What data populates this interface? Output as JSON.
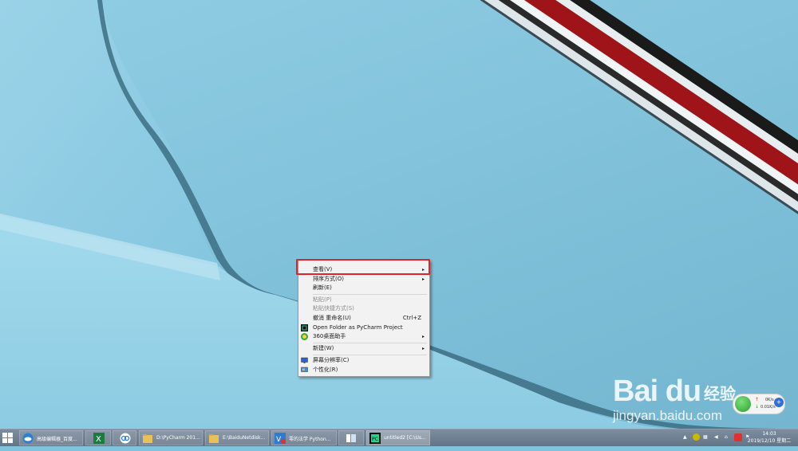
{
  "menu": {
    "items": [
      {
        "label": "查看(V)",
        "has_submenu": true,
        "disabled": false
      },
      {
        "label": "排序方式(O)",
        "has_submenu": true,
        "disabled": false
      },
      {
        "label": "刷新(E)",
        "has_submenu": false,
        "disabled": false
      },
      {
        "label": "粘贴(P)",
        "has_submenu": false,
        "disabled": true
      },
      {
        "label": "粘贴快捷方式(S)",
        "has_submenu": false,
        "disabled": true
      },
      {
        "label": "撤消 重命名(U)",
        "shortcut": "Ctrl+Z",
        "has_submenu": false,
        "disabled": false
      },
      {
        "label": "Open Folder as PyCharm Project",
        "icon": "pycharm-icon",
        "has_submenu": false,
        "disabled": false
      },
      {
        "label": "360桌面助手",
        "icon": "360-icon",
        "has_submenu": true,
        "disabled": false
      },
      {
        "label": "新建(W)",
        "has_submenu": true,
        "disabled": false
      },
      {
        "label": "屏幕分辨率(C)",
        "icon": "monitor-icon",
        "has_submenu": false,
        "disabled": false
      },
      {
        "label": "个性化(R)",
        "icon": "personalize-icon",
        "has_submenu": false,
        "disabled": false
      }
    ],
    "submenu_arrow": "▸"
  },
  "watermark": {
    "brand": "Bai du",
    "site": "jingyan.baidu.com",
    "tag": "经验"
  },
  "net_speed": {
    "up": "0K/s",
    "down": "0.01K/s",
    "up_arrow": "↑",
    "down_arrow": "↓",
    "plus": "+"
  },
  "taskbar": {
    "start_icon": "windows-logo-icon",
    "items": [
      {
        "label": "高级编辑器_百度...",
        "icon": "cloud-icon"
      },
      {
        "label": "",
        "icon": "excel-icon"
      },
      {
        "label": "",
        "icon": "baidu-netdisk-icon"
      },
      {
        "label": "D:\\PyCharm 201...",
        "icon": "folder-icon"
      },
      {
        "label": "E:\\BaiduNetdisk...",
        "icon": "folder-icon"
      },
      {
        "label": "零的法学 Python...",
        "icon": "app-icon"
      },
      {
        "label": "",
        "icon": "panel-icon"
      },
      {
        "label": "untitled2 [C:\\Us...",
        "icon": "pycharm-icon"
      }
    ],
    "clock_time": "14:03",
    "clock_date": "2019/12/10 星期二"
  },
  "colors": {
    "menu_highlight_border": "#e0242a",
    "taskbar": "#6c7d90"
  }
}
